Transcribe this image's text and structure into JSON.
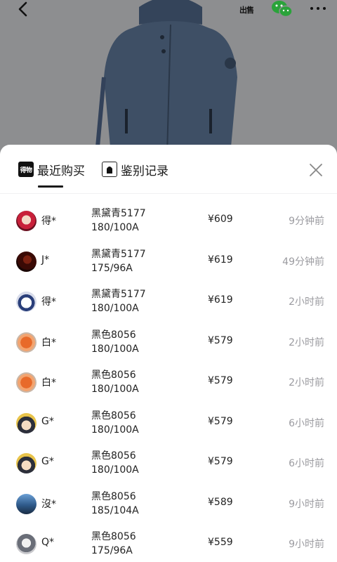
{
  "header": {
    "icons": [
      "back-arrow-icon",
      "sell-icon",
      "wechat-icon",
      "more-icon"
    ],
    "sell_label": "出售"
  },
  "tabs": {
    "recent": {
      "label": "最近购买",
      "icon_text": "得物"
    },
    "auth": {
      "label": "鉴别记录"
    }
  },
  "colors": {
    "sheet_bg": "#ffffff",
    "time_gray": "#9b9ba0",
    "overlay": "#8d8e90",
    "jacket": "#3f5066"
  },
  "purchases": [
    {
      "user": "得*",
      "color": "黑黛青5177",
      "size": "180/100A",
      "price": "¥609",
      "time": "9分钟前",
      "avatar": "red-character"
    },
    {
      "user": "J*",
      "color": "黑黛青5177",
      "size": "175/96A",
      "price": "¥619",
      "time": "49分钟前",
      "avatar": "dark-red-photo"
    },
    {
      "user": "得*",
      "color": "黑黛青5177",
      "size": "180/100A",
      "price": "¥619",
      "time": "2小时前",
      "avatar": "cartoon-face"
    },
    {
      "user": "白*",
      "color": "黑色8056",
      "size": "180/100A",
      "price": "¥579",
      "time": "2小时前",
      "avatar": "orange-character"
    },
    {
      "user": "白*",
      "color": "黑色8056",
      "size": "180/100A",
      "price": "¥579",
      "time": "2小时前",
      "avatar": "orange-character"
    },
    {
      "user": "G*",
      "color": "黑色8056",
      "size": "180/100A",
      "price": "¥579",
      "time": "6小时前",
      "avatar": "anime-boy"
    },
    {
      "user": "G*",
      "color": "黑色8056",
      "size": "180/100A",
      "price": "¥579",
      "time": "6小时前",
      "avatar": "anime-boy"
    },
    {
      "user": "沒*",
      "color": "黑色8056",
      "size": "185/104A",
      "price": "¥589",
      "time": "9小时前",
      "avatar": "blue-sky-photo"
    },
    {
      "user": "Q*",
      "color": "黑色8056",
      "size": "175/96A",
      "price": "¥559",
      "time": "9小时前",
      "avatar": "gray-character"
    }
  ]
}
